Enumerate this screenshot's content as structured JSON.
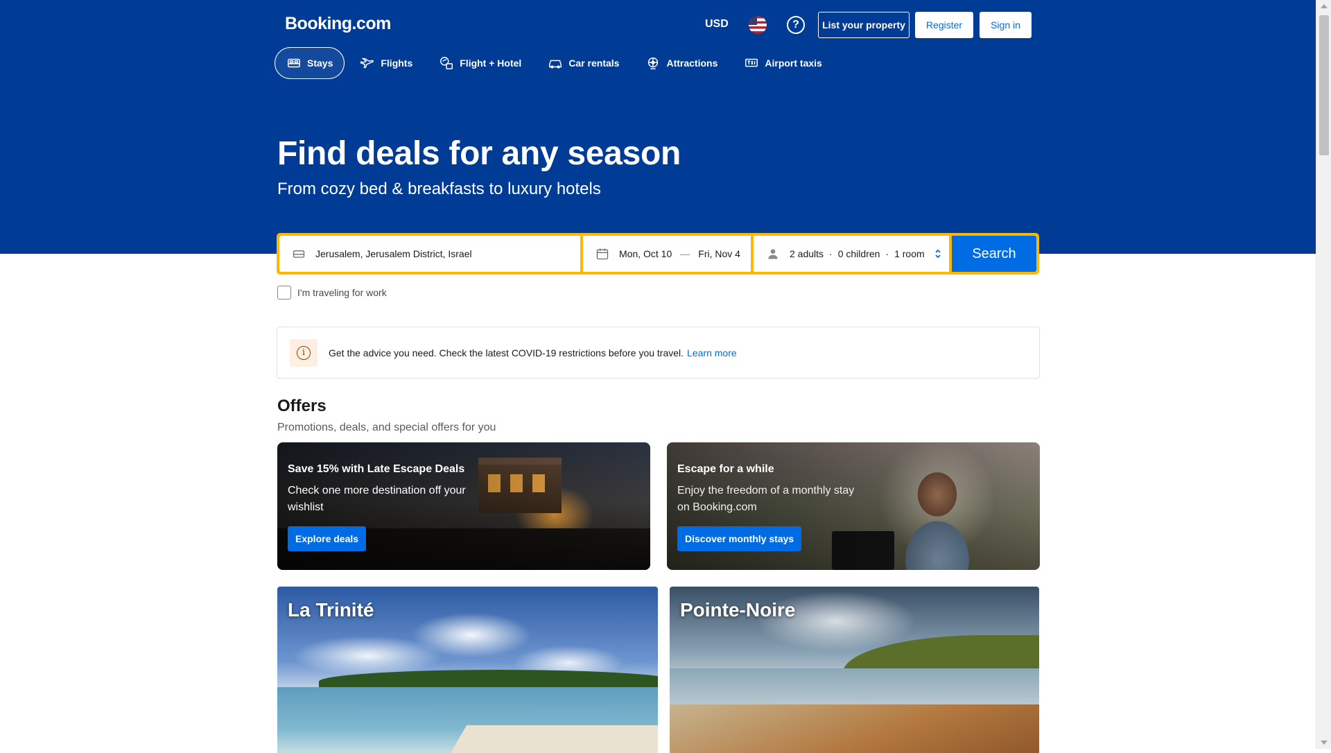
{
  "header": {
    "logo": "Booking.com",
    "currency": "USD",
    "help": "?",
    "list_property": "List your property",
    "register": "Register",
    "sign_in": "Sign in"
  },
  "nav": {
    "tabs": [
      {
        "label": "Stays",
        "icon": "bed-icon",
        "active": true
      },
      {
        "label": "Flights",
        "icon": "plane-icon"
      },
      {
        "label": "Flight + Hotel",
        "icon": "flight-hotel-icon"
      },
      {
        "label": "Car rentals",
        "icon": "car-icon"
      },
      {
        "label": "Attractions",
        "icon": "attractions-icon"
      },
      {
        "label": "Airport taxis",
        "icon": "taxi-icon"
      }
    ]
  },
  "hero": {
    "title": "Find deals for any season",
    "subtitle": "From cozy bed & breakfasts to luxury hotels"
  },
  "search": {
    "destination": "Jerusalem, Jerusalem District, Israel",
    "checkin": "Mon, Oct 10",
    "checkout": "Fri, Nov 4",
    "dates_separator": "—",
    "adults": "2 adults",
    "children": "0 children",
    "rooms": "1 room",
    "dot": "·",
    "button": "Search",
    "work_travel": "I'm traveling for work"
  },
  "notice": {
    "icon": "i",
    "text": "Get the advice you need. Check the latest COVID-19 restrictions before you travel.",
    "link": "Learn more"
  },
  "offers": {
    "title": "Offers",
    "subtitle": "Promotions, deals, and special offers for you",
    "cards": [
      {
        "title": "Save 15% with Late Escape Deals",
        "description": "Check one more destination off your wishlist",
        "button": "Explore deals"
      },
      {
        "title": "Escape for a while",
        "description": "Enjoy the freedom of a monthly stay on Booking.com",
        "button": "Discover monthly stays"
      }
    ]
  },
  "destinations": [
    {
      "name": "La Trinité"
    },
    {
      "name": "Pointe-Noire"
    }
  ],
  "colors": {
    "brand_blue": "#003b95",
    "accent_blue": "#006ce4",
    "search_border": "#ffb700"
  }
}
